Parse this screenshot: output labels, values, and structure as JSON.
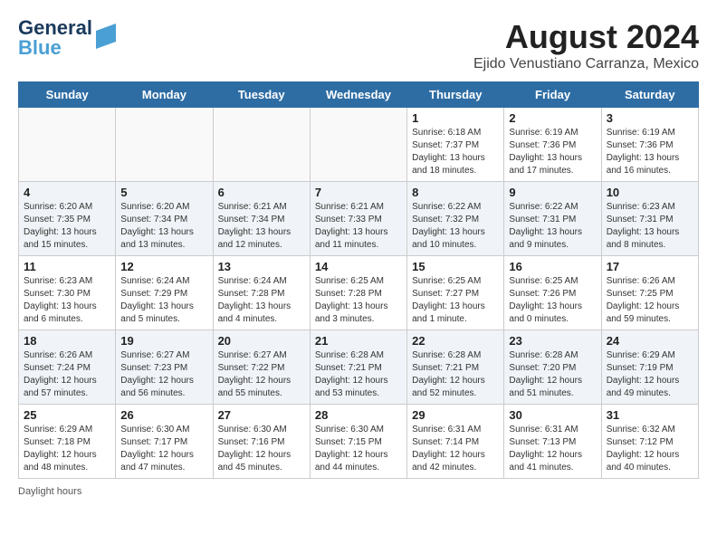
{
  "header": {
    "logo_line1": "General",
    "logo_line2": "Blue",
    "title": "August 2024",
    "subtitle": "Ejido Venustiano Carranza, Mexico"
  },
  "days_of_week": [
    "Sunday",
    "Monday",
    "Tuesday",
    "Wednesday",
    "Thursday",
    "Friday",
    "Saturday"
  ],
  "weeks": [
    [
      {
        "day": "",
        "info": ""
      },
      {
        "day": "",
        "info": ""
      },
      {
        "day": "",
        "info": ""
      },
      {
        "day": "",
        "info": ""
      },
      {
        "day": "1",
        "info": "Sunrise: 6:18 AM\nSunset: 7:37 PM\nDaylight: 13 hours\nand 18 minutes."
      },
      {
        "day": "2",
        "info": "Sunrise: 6:19 AM\nSunset: 7:36 PM\nDaylight: 13 hours\nand 17 minutes."
      },
      {
        "day": "3",
        "info": "Sunrise: 6:19 AM\nSunset: 7:36 PM\nDaylight: 13 hours\nand 16 minutes."
      }
    ],
    [
      {
        "day": "4",
        "info": "Sunrise: 6:20 AM\nSunset: 7:35 PM\nDaylight: 13 hours\nand 15 minutes."
      },
      {
        "day": "5",
        "info": "Sunrise: 6:20 AM\nSunset: 7:34 PM\nDaylight: 13 hours\nand 13 minutes."
      },
      {
        "day": "6",
        "info": "Sunrise: 6:21 AM\nSunset: 7:34 PM\nDaylight: 13 hours\nand 12 minutes."
      },
      {
        "day": "7",
        "info": "Sunrise: 6:21 AM\nSunset: 7:33 PM\nDaylight: 13 hours\nand 11 minutes."
      },
      {
        "day": "8",
        "info": "Sunrise: 6:22 AM\nSunset: 7:32 PM\nDaylight: 13 hours\nand 10 minutes."
      },
      {
        "day": "9",
        "info": "Sunrise: 6:22 AM\nSunset: 7:31 PM\nDaylight: 13 hours\nand 9 minutes."
      },
      {
        "day": "10",
        "info": "Sunrise: 6:23 AM\nSunset: 7:31 PM\nDaylight: 13 hours\nand 8 minutes."
      }
    ],
    [
      {
        "day": "11",
        "info": "Sunrise: 6:23 AM\nSunset: 7:30 PM\nDaylight: 13 hours\nand 6 minutes."
      },
      {
        "day": "12",
        "info": "Sunrise: 6:24 AM\nSunset: 7:29 PM\nDaylight: 13 hours\nand 5 minutes."
      },
      {
        "day": "13",
        "info": "Sunrise: 6:24 AM\nSunset: 7:28 PM\nDaylight: 13 hours\nand 4 minutes."
      },
      {
        "day": "14",
        "info": "Sunrise: 6:25 AM\nSunset: 7:28 PM\nDaylight: 13 hours\nand 3 minutes."
      },
      {
        "day": "15",
        "info": "Sunrise: 6:25 AM\nSunset: 7:27 PM\nDaylight: 13 hours\nand 1 minute."
      },
      {
        "day": "16",
        "info": "Sunrise: 6:25 AM\nSunset: 7:26 PM\nDaylight: 13 hours\nand 0 minutes."
      },
      {
        "day": "17",
        "info": "Sunrise: 6:26 AM\nSunset: 7:25 PM\nDaylight: 12 hours\nand 59 minutes."
      }
    ],
    [
      {
        "day": "18",
        "info": "Sunrise: 6:26 AM\nSunset: 7:24 PM\nDaylight: 12 hours\nand 57 minutes."
      },
      {
        "day": "19",
        "info": "Sunrise: 6:27 AM\nSunset: 7:23 PM\nDaylight: 12 hours\nand 56 minutes."
      },
      {
        "day": "20",
        "info": "Sunrise: 6:27 AM\nSunset: 7:22 PM\nDaylight: 12 hours\nand 55 minutes."
      },
      {
        "day": "21",
        "info": "Sunrise: 6:28 AM\nSunset: 7:21 PM\nDaylight: 12 hours\nand 53 minutes."
      },
      {
        "day": "22",
        "info": "Sunrise: 6:28 AM\nSunset: 7:21 PM\nDaylight: 12 hours\nand 52 minutes."
      },
      {
        "day": "23",
        "info": "Sunrise: 6:28 AM\nSunset: 7:20 PM\nDaylight: 12 hours\nand 51 minutes."
      },
      {
        "day": "24",
        "info": "Sunrise: 6:29 AM\nSunset: 7:19 PM\nDaylight: 12 hours\nand 49 minutes."
      }
    ],
    [
      {
        "day": "25",
        "info": "Sunrise: 6:29 AM\nSunset: 7:18 PM\nDaylight: 12 hours\nand 48 minutes."
      },
      {
        "day": "26",
        "info": "Sunrise: 6:30 AM\nSunset: 7:17 PM\nDaylight: 12 hours\nand 47 minutes."
      },
      {
        "day": "27",
        "info": "Sunrise: 6:30 AM\nSunset: 7:16 PM\nDaylight: 12 hours\nand 45 minutes."
      },
      {
        "day": "28",
        "info": "Sunrise: 6:30 AM\nSunset: 7:15 PM\nDaylight: 12 hours\nand 44 minutes."
      },
      {
        "day": "29",
        "info": "Sunrise: 6:31 AM\nSunset: 7:14 PM\nDaylight: 12 hours\nand 42 minutes."
      },
      {
        "day": "30",
        "info": "Sunrise: 6:31 AM\nSunset: 7:13 PM\nDaylight: 12 hours\nand 41 minutes."
      },
      {
        "day": "31",
        "info": "Sunrise: 6:32 AM\nSunset: 7:12 PM\nDaylight: 12 hours\nand 40 minutes."
      }
    ]
  ],
  "footer": {
    "note": "Daylight hours"
  }
}
